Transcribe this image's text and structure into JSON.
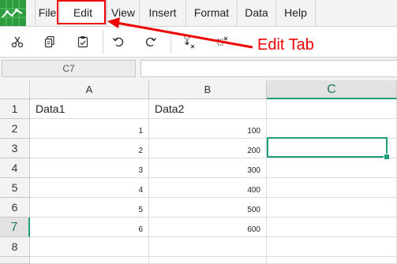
{
  "menu": {
    "tabs": [
      {
        "label": "File"
      },
      {
        "label": "Edit"
      },
      {
        "label": "View"
      },
      {
        "label": "Insert"
      },
      {
        "label": "Format"
      },
      {
        "label": "Data"
      },
      {
        "label": "Help"
      }
    ],
    "active_tab": "Edit"
  },
  "toolbar": {
    "icons": [
      "cut-icon",
      "copy-icon",
      "paste-icon",
      "undo-icon",
      "redo-icon",
      "insert-cells-icon",
      "delete-cells-icon"
    ]
  },
  "annotation": {
    "label": "Edit Tab",
    "color": "#ee0000"
  },
  "formula_bar": {
    "name_box": "C7",
    "formula": ""
  },
  "grid": {
    "columns": [
      "A",
      "B",
      "C"
    ],
    "rows": [
      "1",
      "2",
      "3",
      "4",
      "5",
      "6",
      "7",
      "8"
    ],
    "selected_column": "C",
    "selected_row": "7",
    "cells": {
      "A1": "Data1",
      "B1": "Data2",
      "A2": "1",
      "B2": "100",
      "A3": "2",
      "B3": "200",
      "A4": "3",
      "B4": "300",
      "A5": "4",
      "B5": "400",
      "A6": "5",
      "B6": "500",
      "A7": "6",
      "B7": "600"
    }
  },
  "colors": {
    "accent": "#1e9e7a",
    "logo": "#2d9c3c",
    "highlight": "#ee0000"
  }
}
